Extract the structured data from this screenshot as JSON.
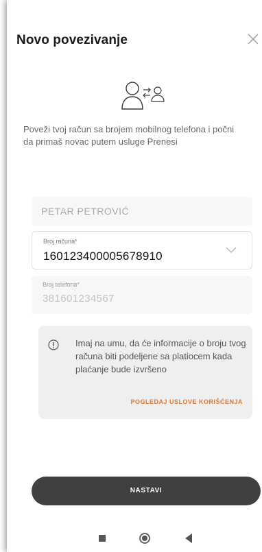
{
  "header": {
    "title": "Novo povezivanje"
  },
  "intro_text": "Poveži tvoj račun sa brojem mobilnog telefona i počni da primaš novac putem usluge Prenesi",
  "form": {
    "name_value": "PETAR PETROVIĆ",
    "account": {
      "label": "Broj računa*",
      "value": "160123400005678910"
    },
    "phone": {
      "label": "Broj telefona*",
      "value": "381601234567"
    }
  },
  "notice": {
    "text": "Imaj na umu, da će informacije o broju tvog računa biti podeljene sa platiocem kada plaćanje bude izvršeno",
    "link_label": "POGLEDAJ USLOVE KORIŠĆENJA"
  },
  "continue_button_label": "NASTAVI",
  "colors": {
    "accent": "#e07a2e",
    "button": "#404040",
    "field_bg": "#f7f7f7",
    "notice_bg": "#efefef"
  },
  "icons": {
    "close": "close-icon",
    "hero": "user-exchange-icon",
    "dropdown": "chevron-down-icon",
    "info": "info-icon"
  }
}
